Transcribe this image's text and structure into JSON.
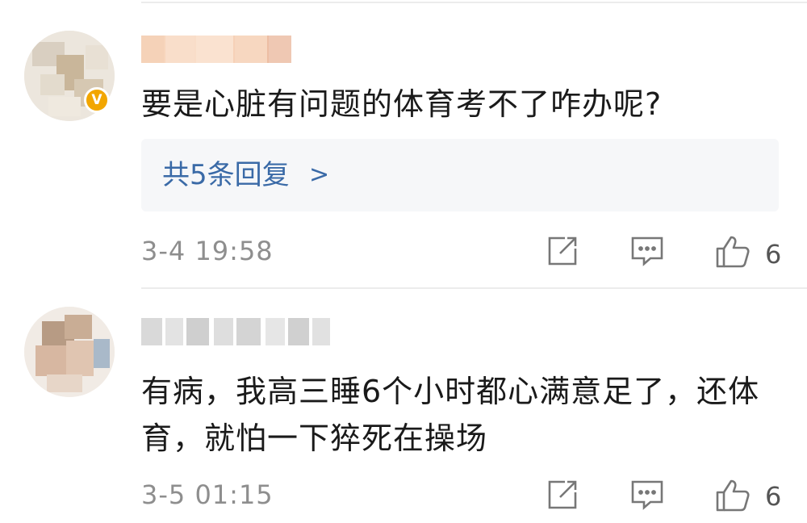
{
  "comments": [
    {
      "username": "",
      "verified": true,
      "text": "要是心脏有问题的体育考不了咋办呢?",
      "replies_label": "共5条回复",
      "replies_chevron": ">",
      "timestamp": "3-4 19:58",
      "likes": "6"
    },
    {
      "username": "",
      "verified": false,
      "text": "有病，我高三睡6个小时都心满意足了，还体育，就怕一下猝死在操场",
      "timestamp": "3-5 01:15",
      "likes": "6"
    }
  ],
  "icons": {
    "verified": "verified-badge-icon",
    "share": "share-icon",
    "reply": "comment-icon",
    "like": "thumbs-up-icon"
  },
  "colors": {
    "link": "#3a6aa7",
    "verified_badge": "#f2a600",
    "meta_text": "#8e8e8e",
    "reply_box_bg": "#f6f7f9"
  }
}
